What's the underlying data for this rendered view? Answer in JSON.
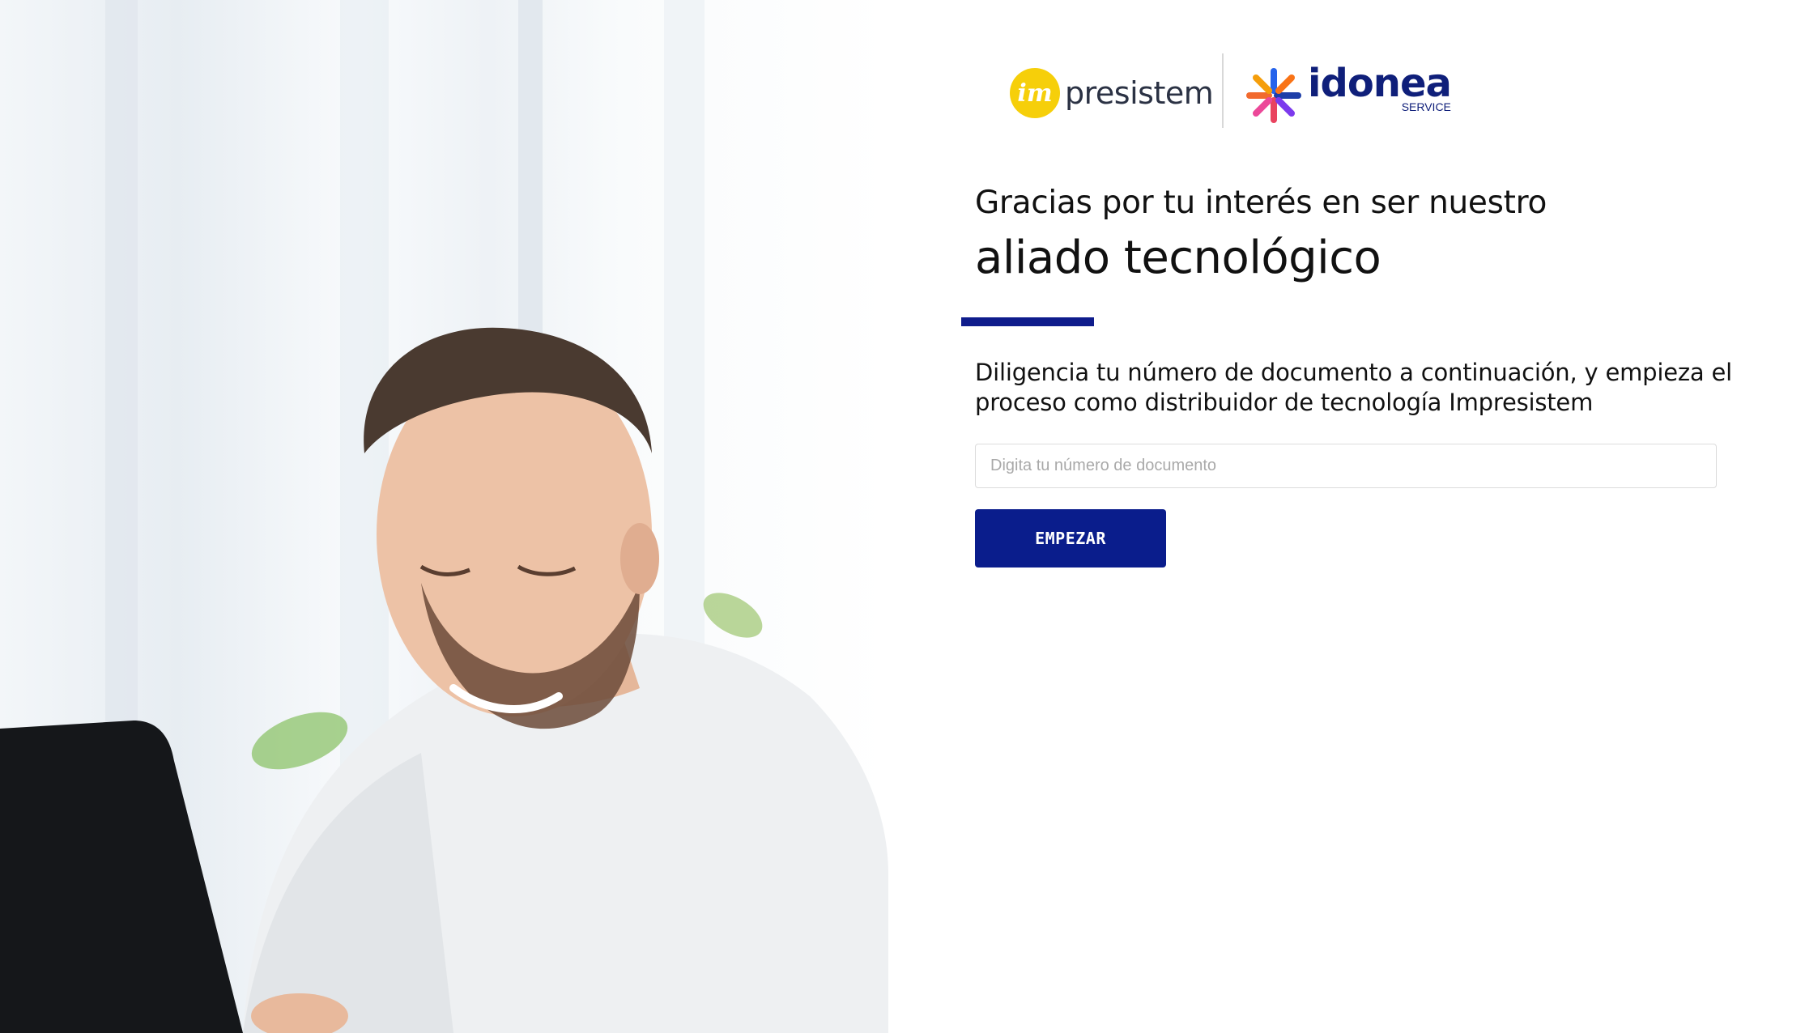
{
  "logos": {
    "impresistem": {
      "badge_text": "im",
      "word": "presistem",
      "badge_color": "#f6cf0a"
    },
    "idonea": {
      "word": "idonea",
      "sub": "SERVICE",
      "brand_color": "#0f1f7a"
    }
  },
  "headline": {
    "line1": "Gracias por tu interés en ser nuestro",
    "line2": "aliado tecnológico"
  },
  "instructions": "Diligencia tu número de documento a continuación, y empieza el proceso como distribuidor de tecnología Impresistem",
  "form": {
    "document_value": "",
    "document_placeholder": "Digita tu número de documento",
    "start_label": "EMPEZAR"
  },
  "colors": {
    "accent": "#0f1c8c",
    "button": "#0a1d8c"
  },
  "icons": {
    "idonea_mark": "starburst-icon"
  }
}
